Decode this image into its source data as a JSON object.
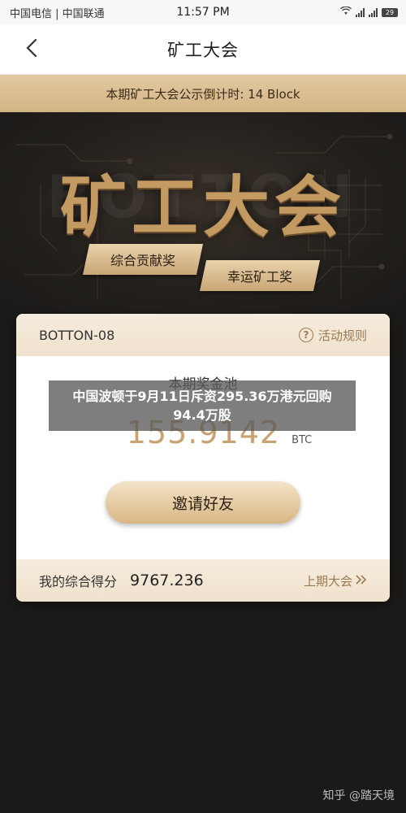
{
  "status_bar": {
    "carriers": "中国电信 | 中国联通",
    "time": "11:57 PM",
    "battery": "29"
  },
  "nav": {
    "title": "矿工大会"
  },
  "countdown": {
    "text": "本期矿工大会公示倒计时: 14 Block"
  },
  "hero": {
    "title": "矿工大会",
    "watermark": "BOTTON",
    "tag_1": "综合贡献奖",
    "tag_2": "幸运矿工奖"
  },
  "card": {
    "id": "BOTTON-08",
    "rules_label": "活动规则",
    "pool_label": "本期奖金池",
    "pool_value": "155.9142",
    "pool_unit": "BTC",
    "invite_label": "邀请好友",
    "score_label": "我的综合得分",
    "score_value": "9767.236",
    "last_label": "上期大会"
  },
  "overlay": {
    "text": "中国波顿于9月11日斥资295.36万港元回购94.4万股"
  },
  "credit": "知乎 @踏天境",
  "colors": {
    "gold": "#c9a271",
    "dark_bg": "#1c1a19",
    "accent_text": "#9a7a52"
  }
}
